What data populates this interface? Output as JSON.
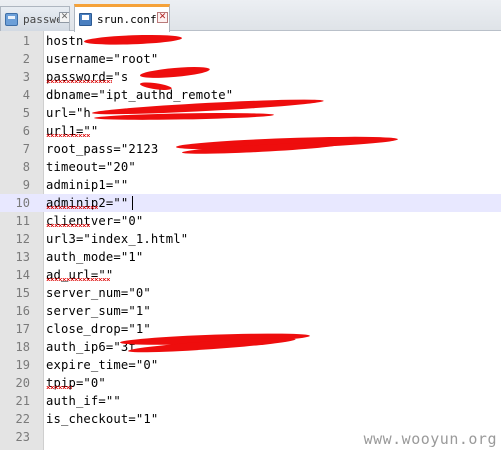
{
  "tabs": [
    {
      "label": "passwe",
      "icon": "file-icon",
      "active": false
    },
    {
      "label": "srun.conf",
      "icon": "save-disk-icon",
      "active": true
    }
  ],
  "close_glyph": "✕",
  "current_line": 10,
  "lines": [
    "hostn",
    "username=\"root\"",
    "password=\"s",
    "dbname=\"ipt_authd_remote\"",
    "url=\"h",
    "url1=\"\"",
    "root_pass=\"2123",
    "timeout=\"20\"",
    "adminip1=\"\"",
    "adminip2=\"\"",
    "clientver=\"0\"",
    "url3=\"index_1.html\"",
    "auth_mode=\"1\"",
    "ad_url=\"\"",
    "server_num=\"0\"",
    "server_sum=\"1\"",
    "close_drop=\"1\"",
    "auth_ip6=\"3f",
    "expire_time=\"0\"",
    "tpip=\"0\"",
    "auth_if=\"\"",
    "is_checkout=\"1\"",
    ""
  ],
  "watermark": "www.wooyun.org"
}
